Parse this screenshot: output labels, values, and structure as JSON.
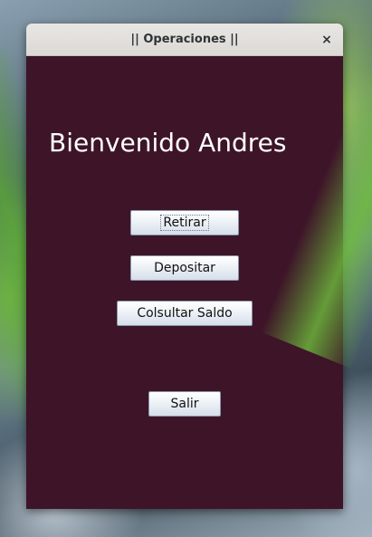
{
  "window": {
    "title": "|| Operaciones ||",
    "close_icon": "close-icon",
    "close_glyph": "×",
    "background_color": "#3d1428"
  },
  "main": {
    "welcome_text": "Bienvenido Andres",
    "buttons": {
      "retirar": "Retirar",
      "depositar": "Depositar",
      "consultar_saldo": "Colsultar Saldo",
      "salir": "Salir"
    }
  }
}
